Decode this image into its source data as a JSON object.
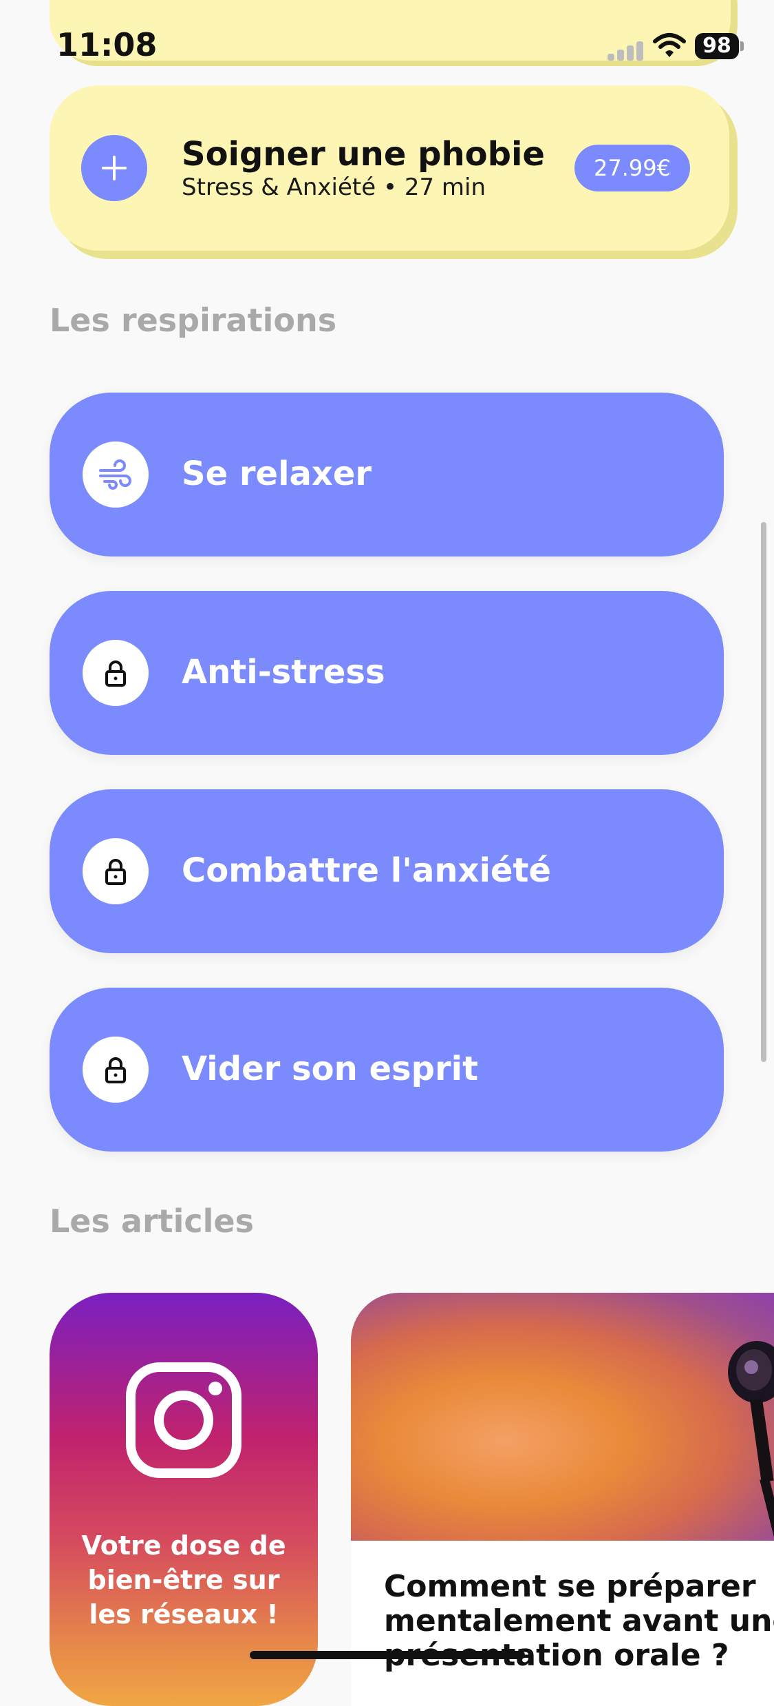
{
  "status_bar": {
    "time": "11:08",
    "battery": "98"
  },
  "phobia_card": {
    "icon": "plus-icon",
    "title": "Soigner une phobie",
    "subtitle": "Stress & Anxiété • 27 min",
    "price": "27.99€"
  },
  "sections": {
    "respirations_title": "Les respirations",
    "articles_title": "Les articles"
  },
  "respirations": [
    {
      "label": "Se relaxer",
      "icon": "wind-icon",
      "locked": false
    },
    {
      "label": "Anti-stress",
      "icon": "lock-icon",
      "locked": true
    },
    {
      "label": "Combattre l'anxiété",
      "icon": "lock-icon",
      "locked": true
    },
    {
      "label": "Vider son esprit",
      "icon": "lock-icon",
      "locked": true
    }
  ],
  "articles": [
    {
      "title": "Votre dose de bien-être sur les réseaux !",
      "icon": "instagram-icon"
    },
    {
      "title_lines": [
        "Comment se préparer",
        "mentalement avant une",
        "présentation orale ?"
      ]
    }
  ],
  "colors": {
    "accent": "#7b8afc",
    "card_yellow": "#fdf5b3",
    "section_title": "#a9a9a9",
    "background": "#f9f9f9"
  }
}
